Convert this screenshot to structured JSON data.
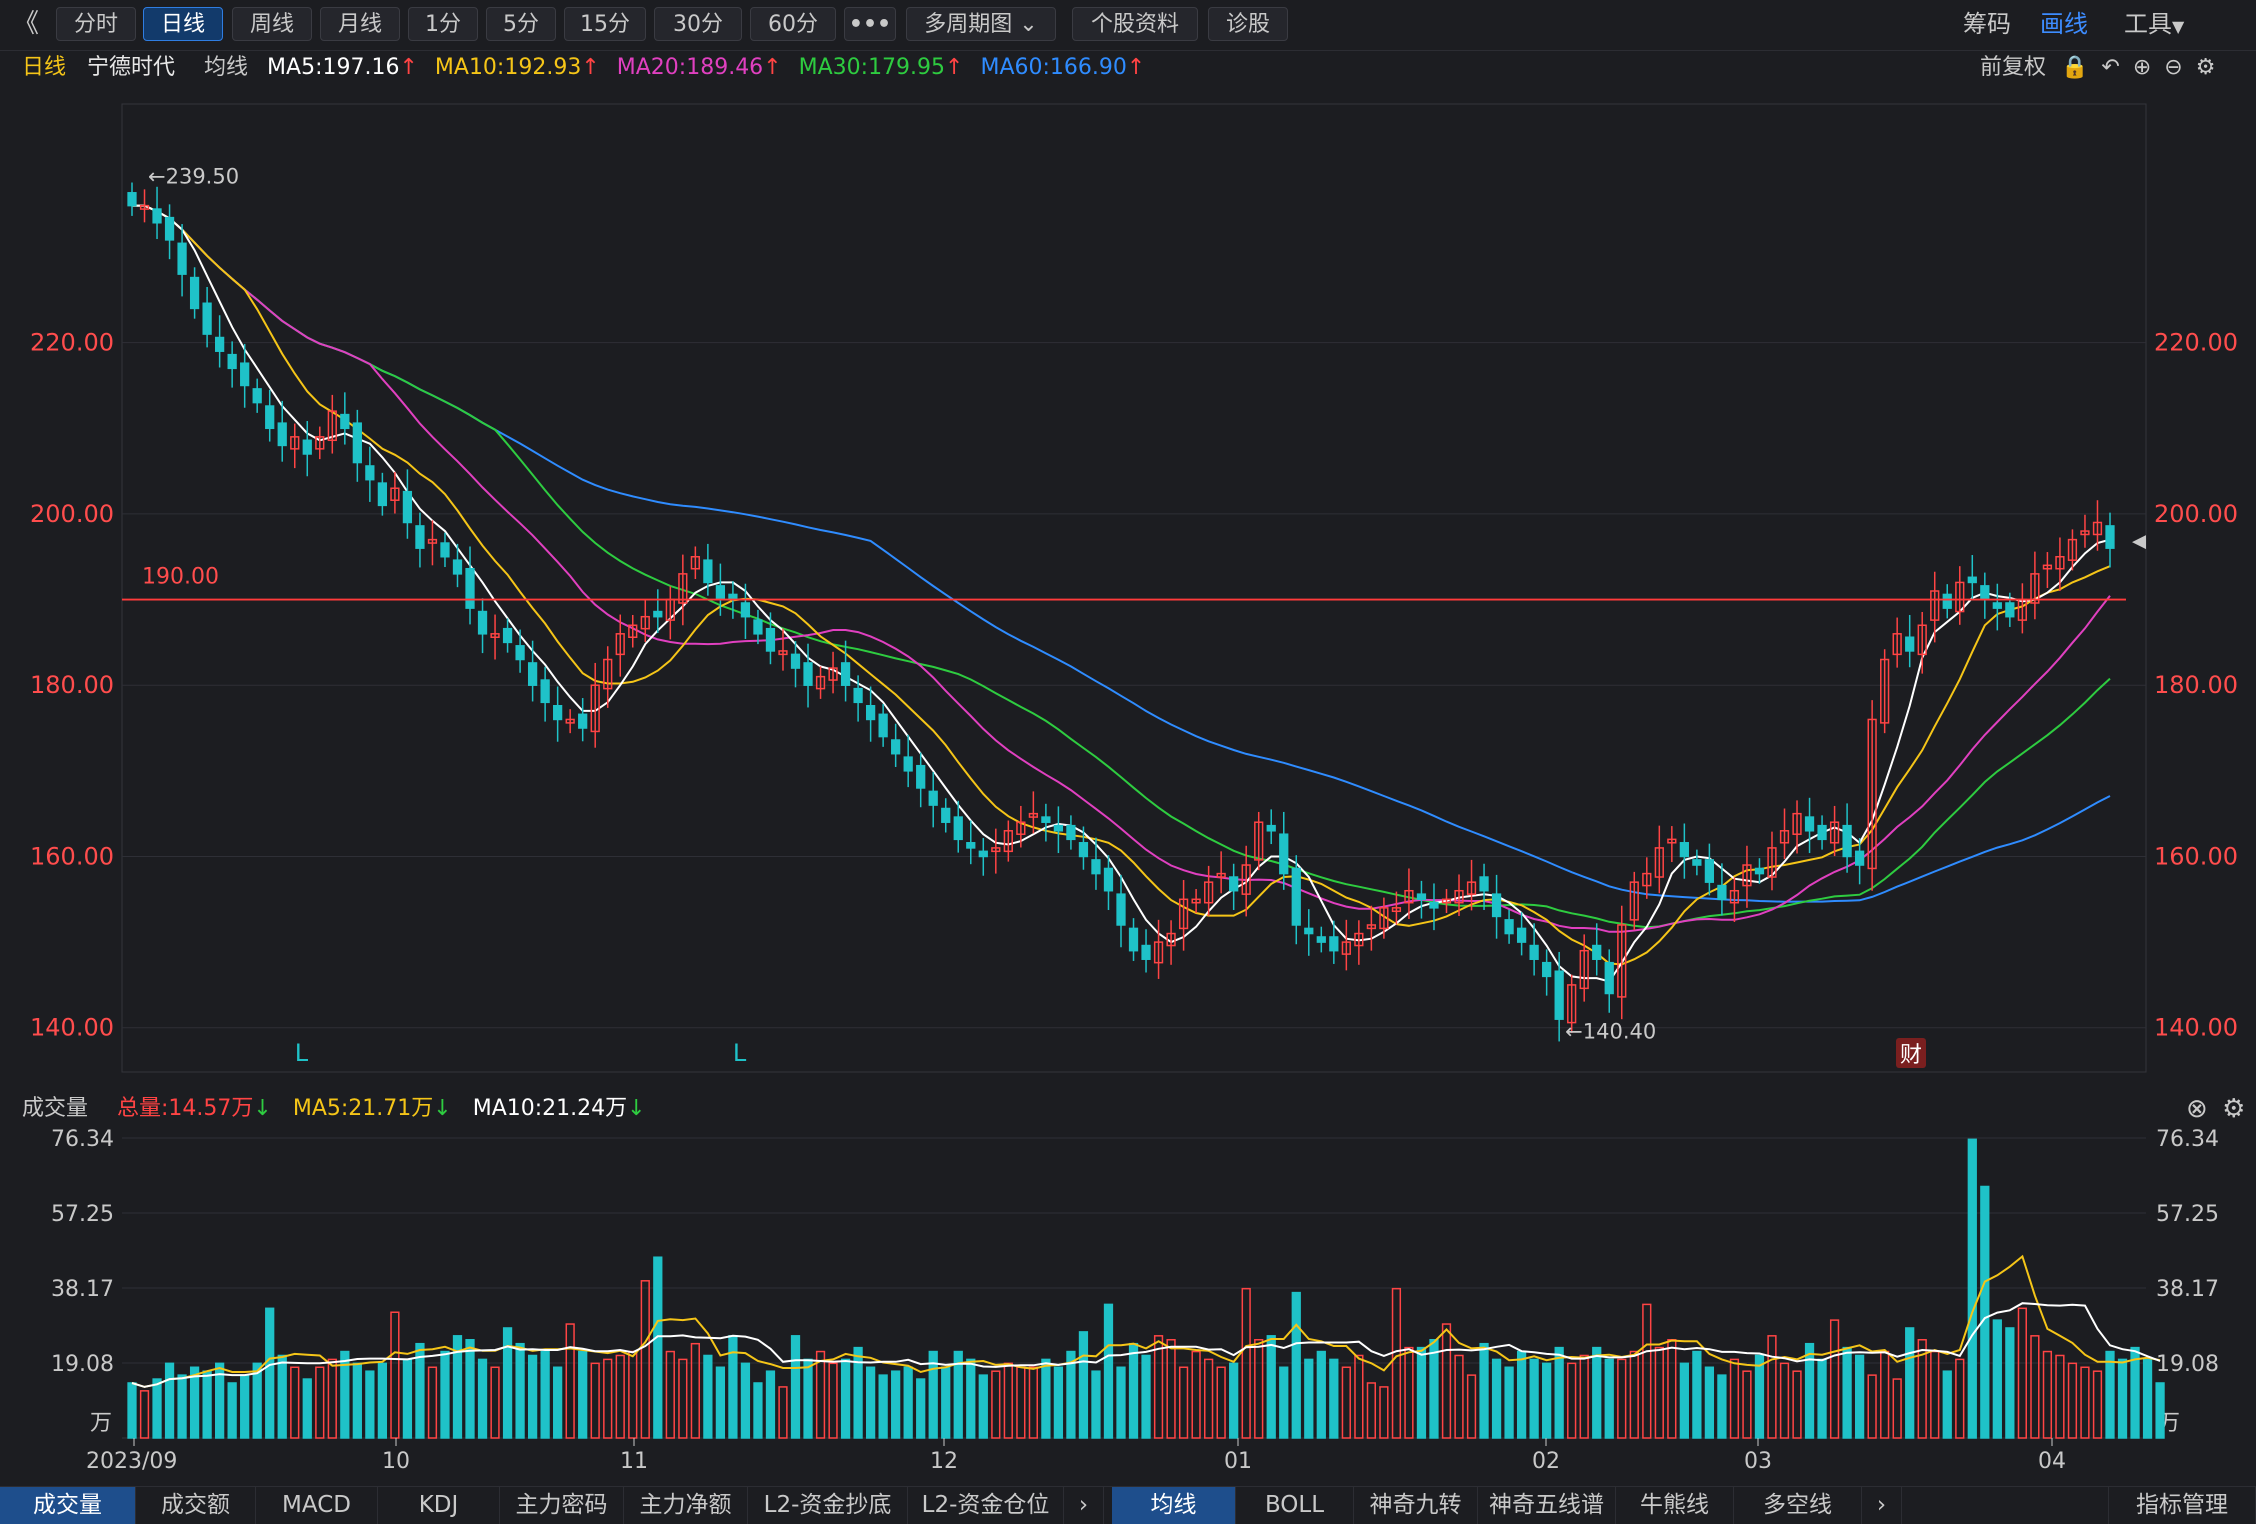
{
  "toolbar": {
    "collapse_icon": "double-chevron-left-icon",
    "periods": [
      "分时",
      "日线",
      "周线",
      "月线",
      "1分",
      "5分",
      "15分",
      "30分",
      "60分"
    ],
    "active_period": "日线",
    "more_label": "•••",
    "multi_period_label": "多周期图",
    "stock_info_label": "个股资料",
    "diagnose_label": "诊股",
    "right_items": [
      "筹码",
      "画线",
      "工具"
    ],
    "highlight_item": "画线"
  },
  "legend": {
    "period": "日线",
    "stock_name": "宁德时代",
    "ma_label": "均线",
    "ma5": "MA5:197.16",
    "ma10": "MA10:192.93",
    "ma20": "MA20:189.46",
    "ma30": "MA30:179.95",
    "ma60": "MA60:166.90",
    "adjust": "前复权",
    "colors": {
      "ma5": "#ffffff",
      "ma10": "#f5c518",
      "ma20": "#e040c0",
      "ma30": "#2ecc40",
      "ma60": "#2f8cff",
      "up": "#ff4444",
      "down": "#1fc2c8"
    }
  },
  "price_axis": {
    "ticks": [
      "220.00",
      "200.00",
      "180.00",
      "160.00",
      "140.00"
    ],
    "tick_values": [
      220,
      200,
      180,
      160,
      140
    ],
    "range": [
      136,
      246
    ]
  },
  "annotations": {
    "high_label": "←239.50",
    "low_label": "←140.40",
    "line_label": "190.00",
    "hline_value": 190,
    "markers": [
      "L",
      "L"
    ],
    "fin_badge": "财"
  },
  "volume_legend": {
    "title": "成交量",
    "total": "总量:14.57万",
    "ma5": "MA5:21.71万",
    "ma10": "MA10:21.24万"
  },
  "volume_axis": {
    "ticks": [
      "76.34",
      "57.25",
      "38.17",
      "19.08",
      "万"
    ],
    "tick_values": [
      76.34,
      57.25,
      38.17,
      19.08
    ],
    "max": 76.34
  },
  "date_axis": [
    "2023/09",
    "10",
    "11",
    "12",
    "01",
    "02",
    "03",
    "04"
  ],
  "bottom_tabs_left": [
    "成交量",
    "成交额",
    "MACD",
    "KDJ",
    "主力密码",
    "主力净额",
    "L2-资金抄底",
    "L2-资金仓位"
  ],
  "bottom_tabs_right": [
    "均线",
    "BOLL",
    "神奇九转",
    "神奇五线谱",
    "牛熊线",
    "多空线"
  ],
  "bottom_right": "指标管理",
  "chart_data": {
    "type": "candlestick",
    "title": "宁德时代 日线",
    "x_start": "2023/09",
    "x_end": "04",
    "series": [
      {
        "name": "MA5",
        "value": 197.16
      },
      {
        "name": "MA10",
        "value": 192.93
      },
      {
        "name": "MA20",
        "value": 189.46
      },
      {
        "name": "MA30",
        "value": 179.95
      },
      {
        "name": "MA60",
        "value": 166.9
      }
    ],
    "highest": 239.5,
    "lowest": 140.4,
    "close_approx": [
      236,
      236,
      234,
      232,
      228,
      224,
      221,
      219,
      217,
      215,
      213,
      210,
      208,
      209,
      207,
      209,
      212,
      210,
      206,
      204,
      201,
      203,
      199,
      196,
      197,
      195,
      193,
      189,
      186,
      186,
      185,
      183,
      180,
      178,
      176,
      176,
      175,
      180,
      183,
      186,
      187,
      188,
      188,
      190,
      193,
      195,
      192,
      190,
      190,
      188,
      186,
      184,
      184,
      182,
      180,
      181,
      182,
      180,
      178,
      176,
      174,
      172,
      170,
      168,
      166,
      164,
      162,
      161,
      160,
      161,
      163,
      164,
      165,
      164,
      163,
      162,
      160,
      158,
      156,
      152,
      149,
      148,
      150,
      151,
      155,
      155,
      157,
      158,
      156,
      159,
      164,
      163,
      158,
      152,
      151,
      150,
      149,
      150,
      151,
      152,
      154,
      154,
      156,
      155,
      154,
      155,
      156,
      157,
      156,
      153,
      151,
      150,
      148,
      146,
      141,
      145,
      149,
      148,
      144,
      152,
      157,
      158,
      161,
      162,
      160,
      159,
      157,
      155,
      156,
      159,
      158,
      161,
      163,
      165,
      163,
      162,
      164,
      160,
      159,
      176,
      183,
      186,
      184,
      187,
      191,
      189,
      192,
      192,
      190,
      189,
      188,
      190,
      193,
      194,
      195,
      197,
      198,
      199,
      196
    ]
  },
  "volume_chart": {
    "type": "bar",
    "values_wan": [
      14,
      12,
      15,
      19,
      16,
      18,
      17,
      19,
      14,
      16,
      19,
      33,
      21,
      18,
      15,
      18,
      20,
      22,
      19,
      17,
      19,
      32,
      20,
      24,
      18,
      22,
      26,
      25,
      20,
      18,
      28,
      24,
      21,
      22,
      18,
      29,
      22,
      19,
      20,
      21,
      22,
      40,
      46,
      22,
      20,
      24,
      21,
      18,
      26,
      19,
      14,
      17,
      13,
      26,
      20,
      22,
      19,
      20,
      23,
      18,
      16,
      17,
      18,
      15,
      22,
      18,
      22,
      20,
      16,
      17,
      19,
      18,
      18,
      20,
      18,
      22,
      27,
      17,
      34,
      18,
      24,
      21,
      26,
      25,
      18,
      22,
      20,
      18,
      19,
      38,
      25,
      26,
      18,
      37,
      20,
      22,
      20,
      18,
      21,
      14,
      13,
      38,
      23,
      23,
      25,
      29,
      21,
      16,
      24,
      20,
      18,
      22,
      20,
      19,
      23,
      19,
      21,
      23,
      20,
      20,
      22,
      34,
      23,
      25,
      19,
      22,
      18,
      16,
      20,
      17,
      21,
      26,
      19,
      17,
      24,
      20,
      30,
      23,
      21,
      16,
      22,
      15,
      28,
      25,
      22,
      17,
      20,
      76,
      64,
      30,
      28,
      33,
      26,
      22,
      21,
      19,
      18,
      17,
      22,
      20,
      23,
      20,
      14
    ]
  }
}
